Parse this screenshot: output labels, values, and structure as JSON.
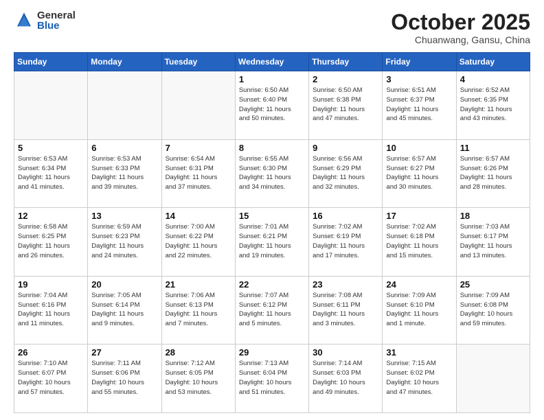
{
  "logo": {
    "general": "General",
    "blue": "Blue"
  },
  "header": {
    "month": "October 2025",
    "location": "Chuanwang, Gansu, China"
  },
  "weekdays": [
    "Sunday",
    "Monday",
    "Tuesday",
    "Wednesday",
    "Thursday",
    "Friday",
    "Saturday"
  ],
  "weeks": [
    [
      {
        "day": "",
        "info": ""
      },
      {
        "day": "",
        "info": ""
      },
      {
        "day": "",
        "info": ""
      },
      {
        "day": "1",
        "info": "Sunrise: 6:50 AM\nSunset: 6:40 PM\nDaylight: 11 hours\nand 50 minutes."
      },
      {
        "day": "2",
        "info": "Sunrise: 6:50 AM\nSunset: 6:38 PM\nDaylight: 11 hours\nand 47 minutes."
      },
      {
        "day": "3",
        "info": "Sunrise: 6:51 AM\nSunset: 6:37 PM\nDaylight: 11 hours\nand 45 minutes."
      },
      {
        "day": "4",
        "info": "Sunrise: 6:52 AM\nSunset: 6:35 PM\nDaylight: 11 hours\nand 43 minutes."
      }
    ],
    [
      {
        "day": "5",
        "info": "Sunrise: 6:53 AM\nSunset: 6:34 PM\nDaylight: 11 hours\nand 41 minutes."
      },
      {
        "day": "6",
        "info": "Sunrise: 6:53 AM\nSunset: 6:33 PM\nDaylight: 11 hours\nand 39 minutes."
      },
      {
        "day": "7",
        "info": "Sunrise: 6:54 AM\nSunset: 6:31 PM\nDaylight: 11 hours\nand 37 minutes."
      },
      {
        "day": "8",
        "info": "Sunrise: 6:55 AM\nSunset: 6:30 PM\nDaylight: 11 hours\nand 34 minutes."
      },
      {
        "day": "9",
        "info": "Sunrise: 6:56 AM\nSunset: 6:29 PM\nDaylight: 11 hours\nand 32 minutes."
      },
      {
        "day": "10",
        "info": "Sunrise: 6:57 AM\nSunset: 6:27 PM\nDaylight: 11 hours\nand 30 minutes."
      },
      {
        "day": "11",
        "info": "Sunrise: 6:57 AM\nSunset: 6:26 PM\nDaylight: 11 hours\nand 28 minutes."
      }
    ],
    [
      {
        "day": "12",
        "info": "Sunrise: 6:58 AM\nSunset: 6:25 PM\nDaylight: 11 hours\nand 26 minutes."
      },
      {
        "day": "13",
        "info": "Sunrise: 6:59 AM\nSunset: 6:23 PM\nDaylight: 11 hours\nand 24 minutes."
      },
      {
        "day": "14",
        "info": "Sunrise: 7:00 AM\nSunset: 6:22 PM\nDaylight: 11 hours\nand 22 minutes."
      },
      {
        "day": "15",
        "info": "Sunrise: 7:01 AM\nSunset: 6:21 PM\nDaylight: 11 hours\nand 19 minutes."
      },
      {
        "day": "16",
        "info": "Sunrise: 7:02 AM\nSunset: 6:19 PM\nDaylight: 11 hours\nand 17 minutes."
      },
      {
        "day": "17",
        "info": "Sunrise: 7:02 AM\nSunset: 6:18 PM\nDaylight: 11 hours\nand 15 minutes."
      },
      {
        "day": "18",
        "info": "Sunrise: 7:03 AM\nSunset: 6:17 PM\nDaylight: 11 hours\nand 13 minutes."
      }
    ],
    [
      {
        "day": "19",
        "info": "Sunrise: 7:04 AM\nSunset: 6:16 PM\nDaylight: 11 hours\nand 11 minutes."
      },
      {
        "day": "20",
        "info": "Sunrise: 7:05 AM\nSunset: 6:14 PM\nDaylight: 11 hours\nand 9 minutes."
      },
      {
        "day": "21",
        "info": "Sunrise: 7:06 AM\nSunset: 6:13 PM\nDaylight: 11 hours\nand 7 minutes."
      },
      {
        "day": "22",
        "info": "Sunrise: 7:07 AM\nSunset: 6:12 PM\nDaylight: 11 hours\nand 5 minutes."
      },
      {
        "day": "23",
        "info": "Sunrise: 7:08 AM\nSunset: 6:11 PM\nDaylight: 11 hours\nand 3 minutes."
      },
      {
        "day": "24",
        "info": "Sunrise: 7:09 AM\nSunset: 6:10 PM\nDaylight: 11 hours\nand 1 minute."
      },
      {
        "day": "25",
        "info": "Sunrise: 7:09 AM\nSunset: 6:08 PM\nDaylight: 10 hours\nand 59 minutes."
      }
    ],
    [
      {
        "day": "26",
        "info": "Sunrise: 7:10 AM\nSunset: 6:07 PM\nDaylight: 10 hours\nand 57 minutes."
      },
      {
        "day": "27",
        "info": "Sunrise: 7:11 AM\nSunset: 6:06 PM\nDaylight: 10 hours\nand 55 minutes."
      },
      {
        "day": "28",
        "info": "Sunrise: 7:12 AM\nSunset: 6:05 PM\nDaylight: 10 hours\nand 53 minutes."
      },
      {
        "day": "29",
        "info": "Sunrise: 7:13 AM\nSunset: 6:04 PM\nDaylight: 10 hours\nand 51 minutes."
      },
      {
        "day": "30",
        "info": "Sunrise: 7:14 AM\nSunset: 6:03 PM\nDaylight: 10 hours\nand 49 minutes."
      },
      {
        "day": "31",
        "info": "Sunrise: 7:15 AM\nSunset: 6:02 PM\nDaylight: 10 hours\nand 47 minutes."
      },
      {
        "day": "",
        "info": ""
      }
    ]
  ]
}
